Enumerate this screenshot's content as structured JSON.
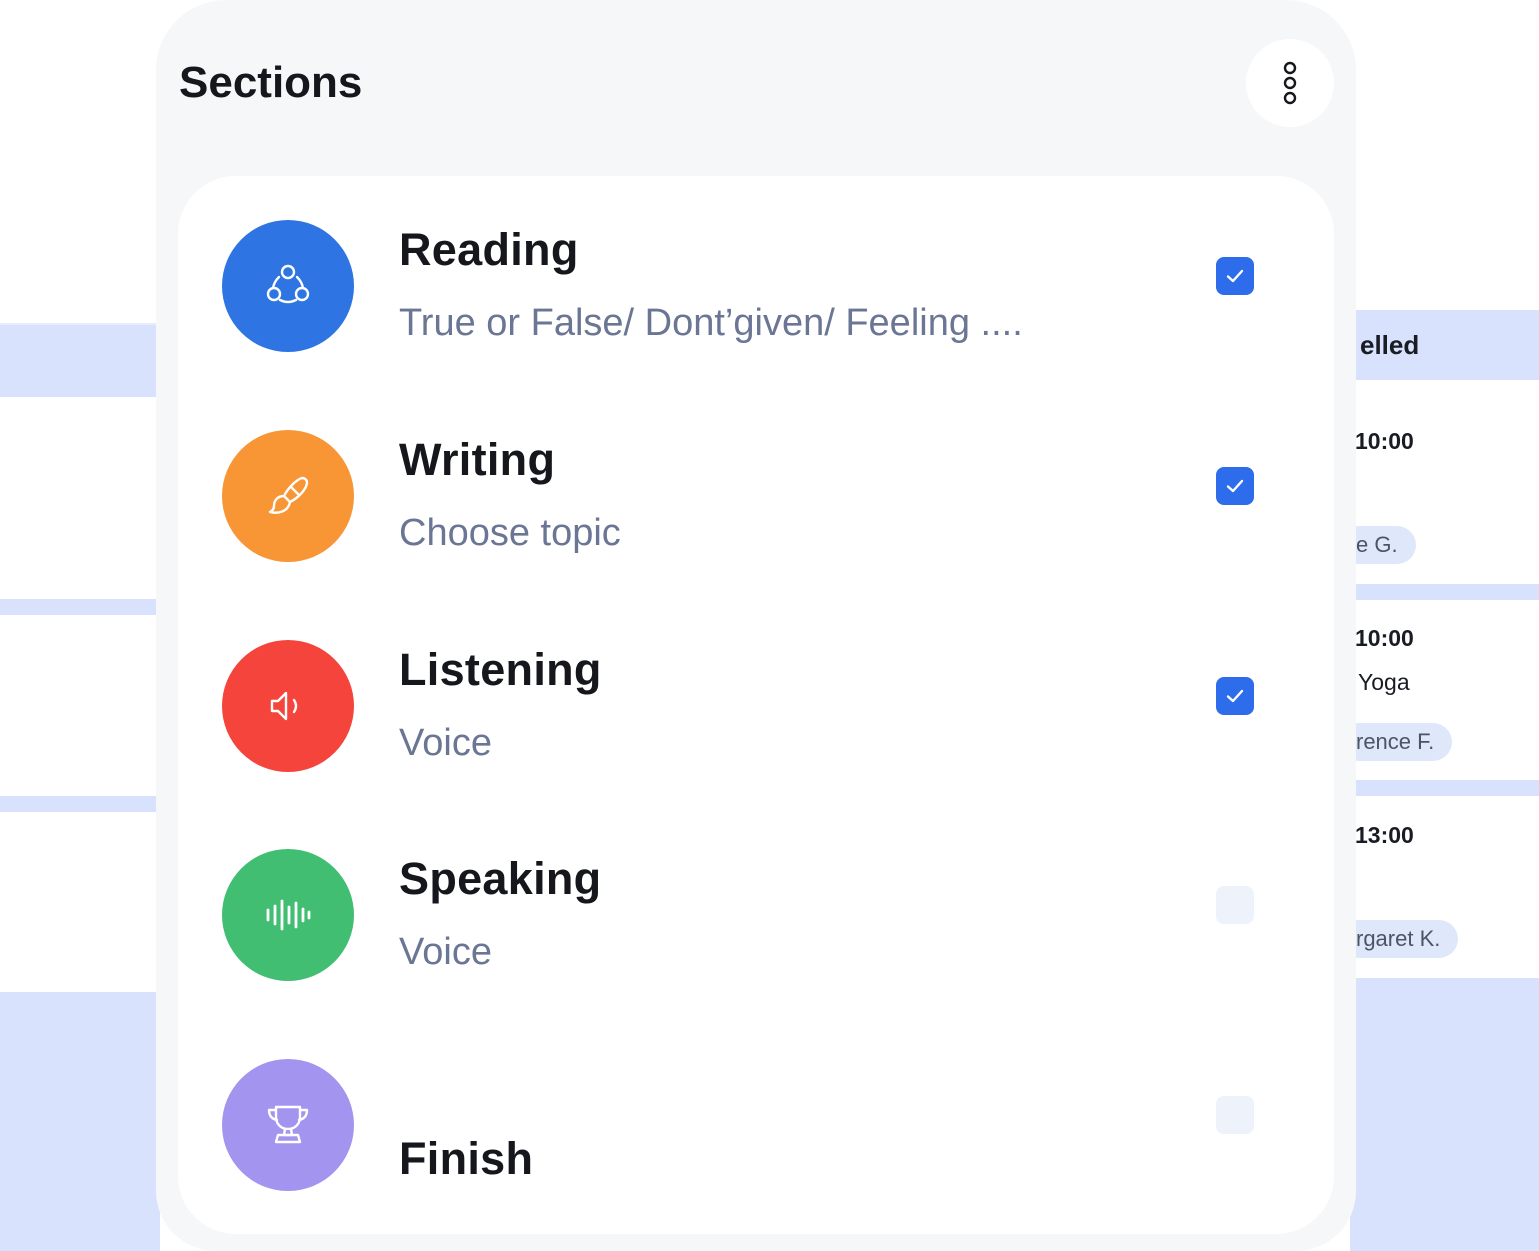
{
  "panel": {
    "title": "Sections"
  },
  "sections": [
    {
      "name": "Reading",
      "description": "True or False/ Dont’given/ Feeling ....",
      "color": "#2e74e2",
      "icon": "share-nodes-icon",
      "checked": true
    },
    {
      "name": "Writing",
      "description": "Choose topic",
      "color": "#f89535",
      "icon": "brush-icon",
      "checked": true
    },
    {
      "name": "Listening",
      "description": "Voice",
      "color": "#f4443b",
      "icon": "speaker-icon",
      "checked": true
    },
    {
      "name": "Speaking",
      "description": "Voice",
      "color": "#42be72",
      "icon": "waveform-icon",
      "checked": false
    },
    {
      "name": "Finish",
      "description": "",
      "color": "#a394ef",
      "icon": "trophy-icon",
      "checked": false
    }
  ],
  "background": {
    "column_header": "elled",
    "entries": [
      {
        "time": "10:00",
        "title": "",
        "person": "e G."
      },
      {
        "time": "10:00",
        "title": "Yoga",
        "person": "rence F."
      },
      {
        "time": "13:00",
        "title": "",
        "person": "rgaret K."
      }
    ]
  },
  "colors": {
    "accent": "#2d6cea",
    "panel_bg": "#f6f7f9",
    "backdrop_blue": "#d8e2fd"
  }
}
